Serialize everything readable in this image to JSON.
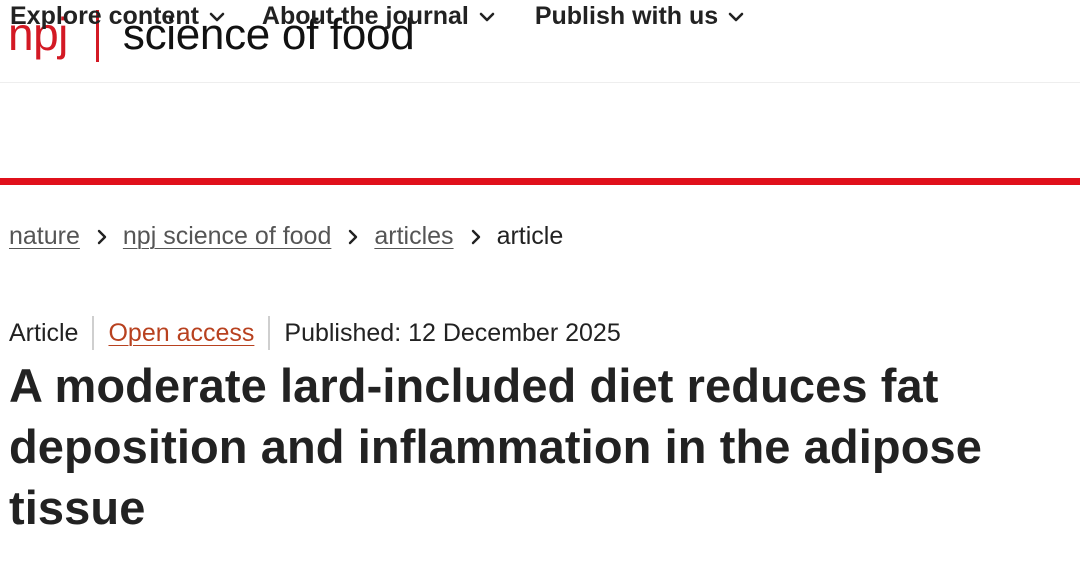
{
  "brand": {
    "npj": "npj",
    "journal": "science of food",
    "color": "#d31924"
  },
  "nav": {
    "items": [
      {
        "label": "Explore content",
        "icon": "chevron-down-icon"
      },
      {
        "label": "About the journal",
        "icon": "chevron-down-icon"
      },
      {
        "label": "Publish with us",
        "icon": "chevron-down-icon"
      }
    ],
    "accent_color": "#e0101b"
  },
  "breadcrumb": {
    "items": [
      {
        "label": "nature"
      },
      {
        "label": "npj science of food"
      },
      {
        "label": "articles"
      }
    ],
    "current": "article",
    "separator_icon": "chevron-right-icon"
  },
  "article": {
    "type": "Article",
    "access": "Open access",
    "access_color": "#b8411f",
    "published": "Published: 12 December 2025",
    "title": "A moderate lard-included diet reduces fat deposition and inflammation in the adipose tissue"
  }
}
